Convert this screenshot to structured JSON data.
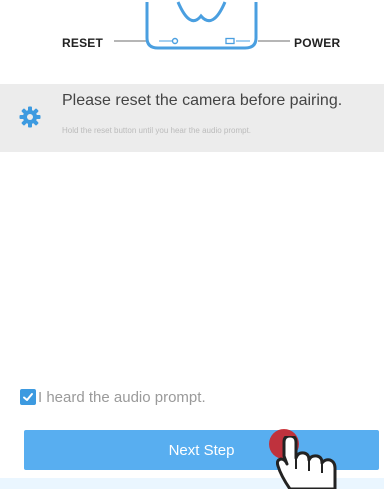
{
  "diagram": {
    "reset_label": "RESET",
    "power_label": "POWER"
  },
  "tip": {
    "icon": "gear-icon",
    "title": "Please reset the camera before pairing.",
    "subtitle": "Hold the reset button until you hear the audio prompt."
  },
  "confirm": {
    "checked": true,
    "label": "I heard the audio prompt."
  },
  "next_button": {
    "label": "Next Step"
  },
  "colors": {
    "accent": "#58aef0",
    "checkbox": "#3d9ae0",
    "tip_background": "#ececec",
    "tap_indicator": "#c8272e"
  }
}
